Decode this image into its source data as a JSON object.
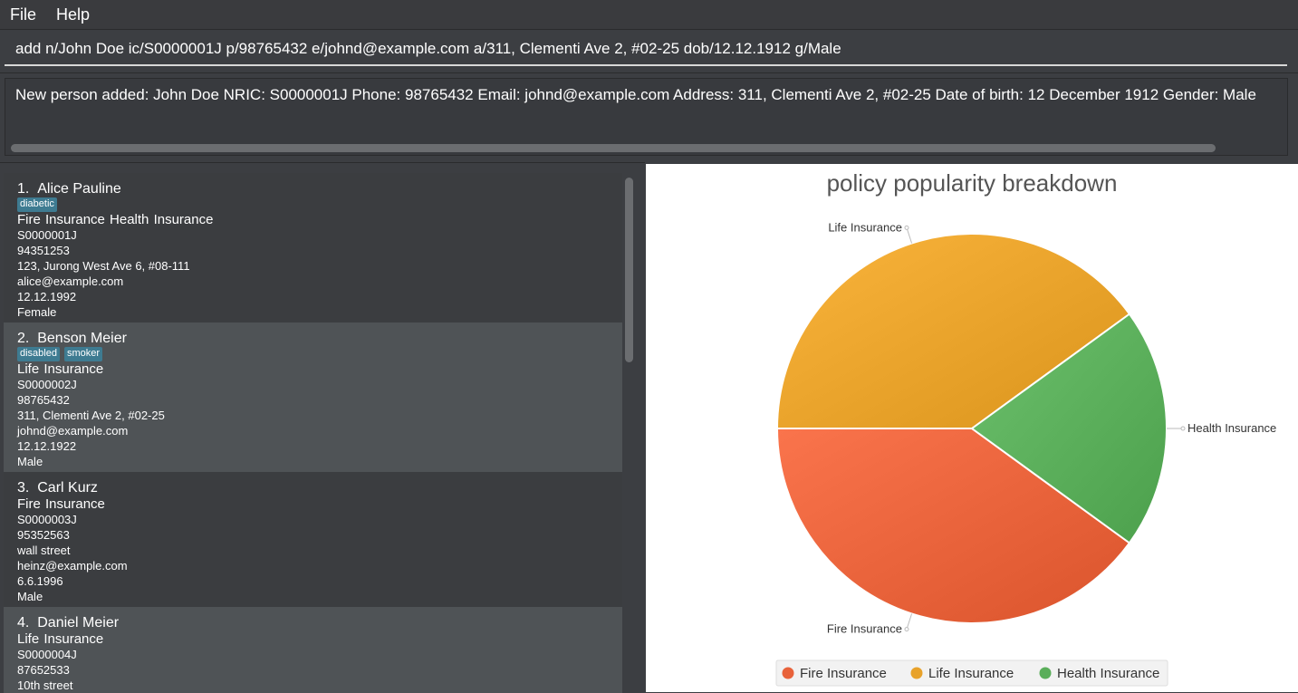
{
  "menu": {
    "file": "File",
    "help": "Help"
  },
  "command": {
    "value": "add n/John Doe ic/S0000001J p/98765432 e/johnd@example.com a/311, Clementi Ave 2, #02-25 dob/12.12.1912 g/Male"
  },
  "result": {
    "text": "New person added: John Doe NRIC: S0000001J Phone: 98765432 Email: johnd@example.com Address: 311, Clementi Ave 2, #02-25 Date of birth: 12 December 1912 Gender: Male"
  },
  "persons": [
    {
      "index": "1.",
      "name": "Alice Pauline",
      "tags": [
        "diabetic"
      ],
      "policies": "Fire Insurance  Health Insurance",
      "nric": "S0000001J",
      "phone": "94351253",
      "address": "123, Jurong West Ave 6, #08-111",
      "email": "alice@example.com",
      "dob": "12.12.1992",
      "gender": "Female"
    },
    {
      "index": "2.",
      "name": "Benson Meier",
      "tags": [
        "disabled",
        "smoker"
      ],
      "policies": "Life Insurance",
      "nric": "S0000002J",
      "phone": "98765432",
      "address": "311, Clementi Ave 2, #02-25",
      "email": "johnd@example.com",
      "dob": "12.12.1922",
      "gender": "Male"
    },
    {
      "index": "3.",
      "name": "Carl Kurz",
      "tags": [],
      "policies": "Fire Insurance",
      "nric": "S0000003J",
      "phone": "95352563",
      "address": "wall street",
      "email": "heinz@example.com",
      "dob": "6.6.1996",
      "gender": "Male"
    },
    {
      "index": "4.",
      "name": "Daniel Meier",
      "tags": [],
      "policies": "Life Insurance",
      "nric": "S0000004J",
      "phone": "87652533",
      "address": "10th street",
      "email": "",
      "dob": "",
      "gender": ""
    }
  ],
  "chart_data": {
    "type": "pie",
    "title": "policy popularity breakdown",
    "slices": [
      {
        "label": "Fire Insurance",
        "value": 2,
        "color": "#e8623a"
      },
      {
        "label": "Life Insurance",
        "value": 2,
        "color": "#e8a22a"
      },
      {
        "label": "Health Insurance",
        "value": 1,
        "color": "#5aae5a"
      }
    ],
    "legend": [
      "Fire Insurance",
      "Life Insurance",
      "Health Insurance"
    ],
    "legend_position": "bottom"
  }
}
